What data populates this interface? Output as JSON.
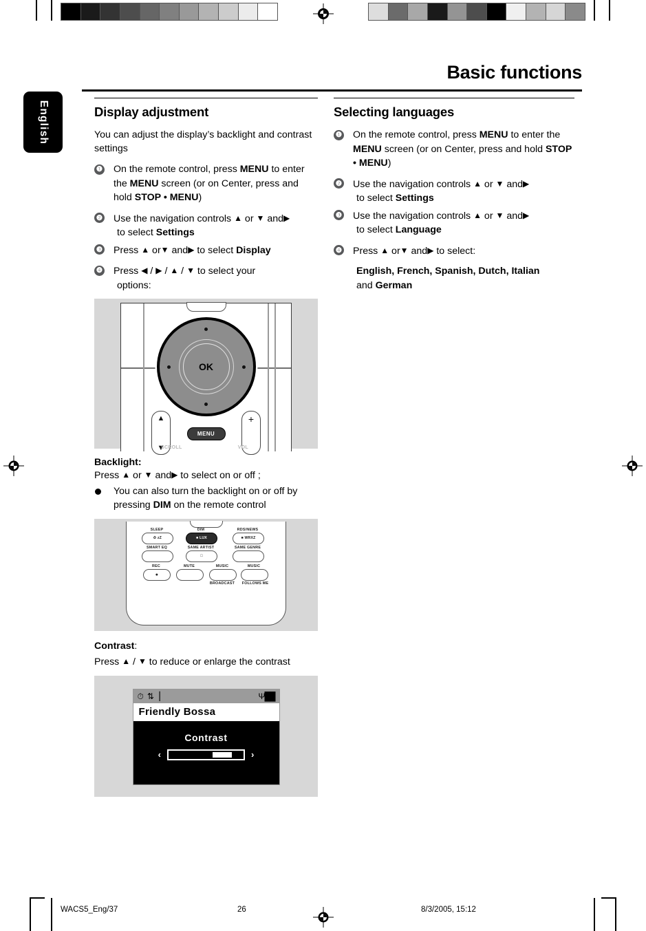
{
  "document": {
    "header_title": "Basic functions",
    "language_tab": "English"
  },
  "calibration": {
    "left_strip_name": "grayscale-step-wedge",
    "left_swatches": [
      "#000000",
      "#1a1a1a",
      "#333333",
      "#4d4d4d",
      "#666666",
      "#808080",
      "#999999",
      "#b3b3b3",
      "#cccccc",
      "#ececec",
      "#ffffff"
    ],
    "right_strip_name": "scrambled-grayscale-wedge",
    "right_swatches": [
      "#dddddd",
      "#6b6b6b",
      "#a8a8a8",
      "#1a1a1a",
      "#949494",
      "#4d4d4d",
      "#000000",
      "#f0f0f0",
      "#b3b3b3",
      "#d6d6d6",
      "#8a8a8a"
    ]
  },
  "left_column": {
    "section_title": "Display adjustment",
    "intro": "You can adjust the display’s  backlight and contrast settings",
    "steps": [
      {
        "num": "❶",
        "html": "On the remote control, press <b>MENU</b> to enter the <b>MENU</b> screen (or on Center, press and hold <b>STOP • MENU</b>)"
      },
      {
        "num": "❷",
        "html": "Use the navigation controls <span class=\"ar\">▲</span> or <span class=\"ar\">▼</span> and<span class=\"ar\">▶</span><span class=\"sub\">to select <b>Settings</b></span>"
      },
      {
        "num": "❸",
        "html": "Press <span class=\"ar\">▲</span> or<span class=\"ar\">▼</span> and<span class=\"ar\">▶</span> to  select <b>Display</b>"
      },
      {
        "num": "❹",
        "html": "Press <span class=\"ar\">◀</span> / <span class=\"ar\">▶</span> / <span class=\"ar\">▲</span> / <span class=\"ar\">▼</span> to  select  your<span class=\"sub\">options:</span>"
      }
    ],
    "backlight": {
      "title": "Backlight:",
      "instruction_html": "Press <span class=\"ar\">▲</span>  or  <span class=\"ar\">▼</span>  and<span class=\"ar\">▶</span> to select on or off ;",
      "bullet_html": "You can also turn the backlight on or off by pressing <b>DIM</b> on the remote control"
    },
    "contrast": {
      "title_bold": "Contrast",
      "title_colon": ":",
      "instruction_html": "Press <span class=\"ar\">▲</span> /  <span class=\"ar\">▼</span>  to reduce or enlarge the contrast"
    }
  },
  "right_column": {
    "section_title": "Selecting languages",
    "steps": [
      {
        "num": "❶",
        "html": "On the remote control, press <b>MENU</b> to enter the <b>MENU</b> screen (or on Center, press and hold <b>STOP • MENU</b>)"
      },
      {
        "num": "❷",
        "html": "Use the navigation controls <span class=\"ar\">▲</span>  or  <span class=\"ar\">▼</span> and<span class=\"ar\">▶</span><span class=\"sub\">to select <b>Settings</b></span>"
      },
      {
        "num": "❸",
        "html": "Use the navigation controls <span class=\"ar\">▲</span>  or  <span class=\"ar\">▼</span>  and<span class=\"ar\">▶</span><span class=\"sub\">to select <b>Language</b></span>"
      },
      {
        "num": "❹",
        "html": "Press  <span class=\"ar\">▲</span>  or<span class=\"ar\">▼</span>  and<span class=\"ar\">▶</span> to  select:"
      }
    ],
    "languages_html": "<b>English, French, Spanish, Dutch, Italian</b><br>and <b>German</b>"
  },
  "figure_navigation": {
    "ok_label": "OK",
    "menu_label": "MENU",
    "up_glyph": "▲",
    "down_glyph": "▼",
    "plus_glyph": "+",
    "faint_left_label": "SCROLL",
    "faint_right_label": "VOL"
  },
  "figure_remote": {
    "buttons": [
      {
        "label": "SLEEP",
        "glyph": "⏱ zZ",
        "dark": false
      },
      {
        "label": "DIM",
        "glyph": "■ LUX",
        "dark": true
      },
      {
        "label": "RDS/NEWS",
        "glyph": "■ WRXZ",
        "dark": false
      },
      {
        "label": "SMART EQ",
        "glyph": "",
        "dark": false
      },
      {
        "label": "SAME ARTIST",
        "glyph": "□",
        "dark": false
      },
      {
        "label": "SAME GENRE",
        "glyph": "",
        "dark": false
      },
      {
        "label": "REC",
        "glyph": "●",
        "dark": false
      },
      {
        "label": "MUTE",
        "glyph": "",
        "dark": false
      },
      {
        "label": "MUSIC",
        "glyph": "",
        "dark": false,
        "sublabel": "BROADCAST"
      },
      {
        "label": "MUSIC",
        "glyph": "",
        "dark": false,
        "sublabel": "FOLLOWS ME"
      }
    ]
  },
  "figure_screen": {
    "status_icons": [
      "clock-icon",
      "shuffle-repeat-icon",
      "eq-bars-icon"
    ],
    "signal_icon": "Ψ██",
    "track_title": "Friendly Bossa",
    "menu_label": "Contrast",
    "left_arrow": "‹",
    "right_arrow": "›",
    "slider_percent": 78
  },
  "footer": {
    "file": "WACS5_Eng/37",
    "page": "26",
    "date": "8/3/2005, 15:12"
  }
}
